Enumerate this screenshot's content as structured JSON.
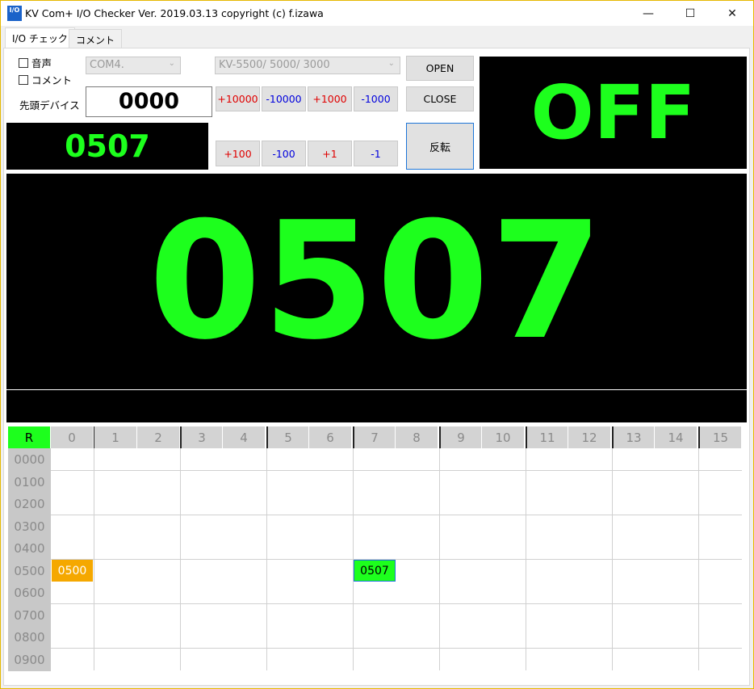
{
  "window": {
    "title": "KV Com+ I/O Checker Ver. 2019.03.13 copyright (c) f.izawa",
    "icon_text": "I/O",
    "minimize": "—",
    "maximize": "☐",
    "close": "✕"
  },
  "tabs": [
    {
      "label": "I/O チェック"
    },
    {
      "label": "コメント"
    }
  ],
  "controls": {
    "sound_label": "音声",
    "comment_label": "コメント",
    "device_label": "先頭デバイス",
    "device_value": "0000",
    "port": "COM4.",
    "plc_model": "KV-5500/ 5000/ 3000",
    "open": "OPEN",
    "close": "CLOSE",
    "invert": "反転",
    "step_buttons": [
      "+10000",
      "-10000",
      "+1000",
      "-1000",
      "+100",
      "-100",
      "+1",
      "-1"
    ]
  },
  "displays": {
    "small_value": "0507",
    "status": "OFF",
    "big_value": "0507",
    "comment_text": ""
  },
  "grid": {
    "corner": "R",
    "columns": [
      "0",
      "1",
      "2",
      "3",
      "4",
      "5",
      "6",
      "7",
      "8",
      "9",
      "10",
      "11",
      "12",
      "13",
      "14",
      "15"
    ],
    "rows": [
      "0000",
      "0100",
      "0200",
      "0300",
      "0400",
      "0500",
      "0600",
      "0700",
      "0800",
      "0900"
    ],
    "highlights": [
      {
        "label": "0500",
        "row": "0500",
        "col": "0",
        "color": "#f5a800"
      },
      {
        "label": "0507",
        "row": "0500",
        "col": "7",
        "color": "#1dff1d"
      }
    ]
  },
  "colors": {
    "display_green": "#1dff1d",
    "orange": "#f5a800",
    "red_text": "#e00000",
    "blue_text": "#0000dd"
  }
}
